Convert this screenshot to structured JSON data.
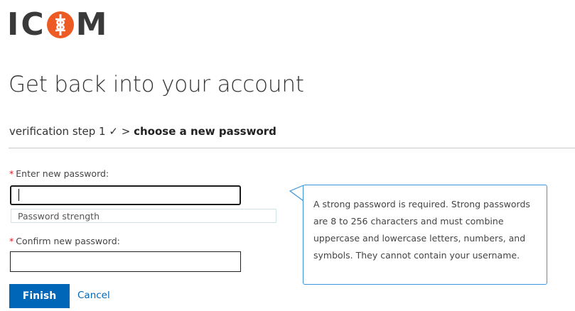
{
  "logo": {
    "letter_1": "I",
    "letter_2": "C",
    "letter_4": "M",
    "mark_icon": "caduceus-circle-icon",
    "mark_color": "#ee5a24"
  },
  "page_title": "Get back into your account",
  "steps": {
    "completed": "verification step 1",
    "check_icon": "✓",
    "separator": ">",
    "current": "choose a new password"
  },
  "form": {
    "new_password": {
      "required_marker": "*",
      "label": "Enter new password:",
      "value": ""
    },
    "strength_text": "Password strength",
    "confirm_password": {
      "required_marker": "*",
      "label": "Confirm new password:",
      "value": ""
    }
  },
  "tooltip": {
    "text": "A strong password is required. Strong passwords are 8 to 256 characters and must combine uppercase and lowercase letters, numbers, and symbols. They cannot contain your username."
  },
  "actions": {
    "finish_label": "Finish",
    "cancel_label": "Cancel"
  },
  "colors": {
    "accent": "#0067b8",
    "required": "#e81123",
    "tooltip_border": "#3a96dd"
  }
}
